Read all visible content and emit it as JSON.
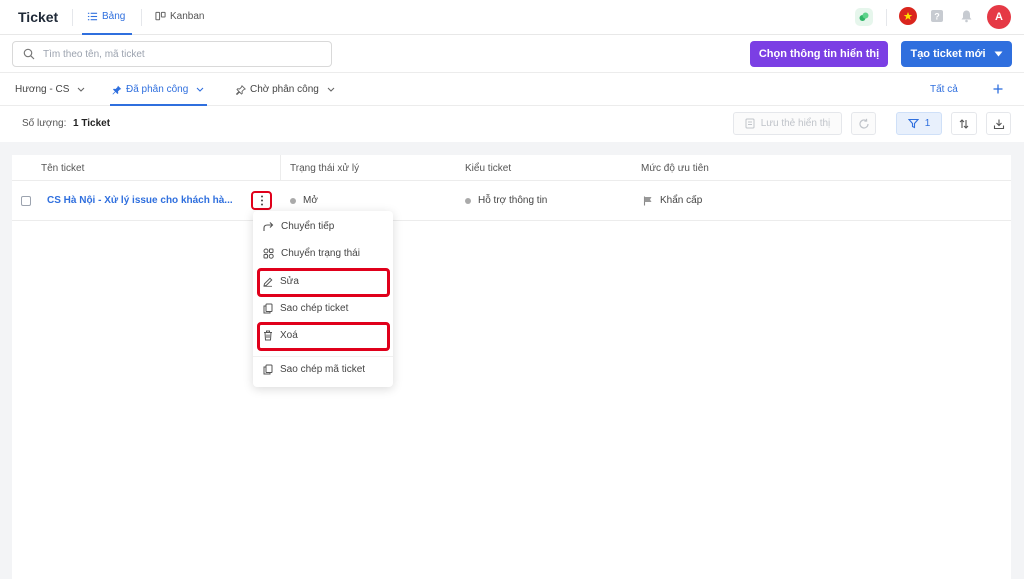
{
  "header": {
    "title": "Ticket",
    "tabs": [
      {
        "label": "Bảng",
        "active": true,
        "icon": "list-icon"
      },
      {
        "label": "Kanban",
        "active": false,
        "icon": "kanban-icon"
      }
    ],
    "avatar_letter": "A"
  },
  "toolbar": {
    "search_placeholder": "Tìm theo tên, mã ticket",
    "display_button": "Chọn thông tin hiển thị",
    "create_button": "Tạo ticket mới"
  },
  "filters": {
    "tabs": [
      {
        "label": "Hương - CS",
        "active": false
      },
      {
        "label": "Đã phân công",
        "active": true
      },
      {
        "label": "Chờ phân công",
        "active": false
      }
    ],
    "all_label": "Tất cả"
  },
  "summary": {
    "count_label": "Số lượng:",
    "count_value": "1 Ticket",
    "save_view_label": "Lưu thẻ hiển thị",
    "filter_count": "1"
  },
  "table": {
    "columns": [
      "Tên ticket",
      "Trạng thái xử lý",
      "Kiểu ticket",
      "Mức độ ưu tiên"
    ],
    "rows": [
      {
        "name": "CS Hà Nội - Xử lý issue cho khách hà...",
        "status": "Mở",
        "type": "Hỗ trợ thông tin",
        "priority": "Khẩn cấp"
      }
    ]
  },
  "context_menu": {
    "items": [
      {
        "label": "Chuyển tiếp",
        "icon": "forward-icon",
        "highlighted": false
      },
      {
        "label": "Chuyển trạng thái",
        "icon": "status-icon",
        "highlighted": false
      },
      {
        "label": "Sửa",
        "icon": "edit-icon",
        "highlighted": true
      },
      {
        "label": "Sao chép ticket",
        "icon": "copy-icon",
        "highlighted": false
      },
      {
        "label": "Xoá",
        "icon": "trash-icon",
        "highlighted": true
      },
      {
        "label": "Sao chép mã ticket",
        "icon": "copy-icon",
        "highlighted": false
      }
    ]
  },
  "colors": {
    "primary": "#2f6fde",
    "purple": "#7b3fe4",
    "highlight_red": "#e0001b",
    "avatar": "#e53945"
  }
}
